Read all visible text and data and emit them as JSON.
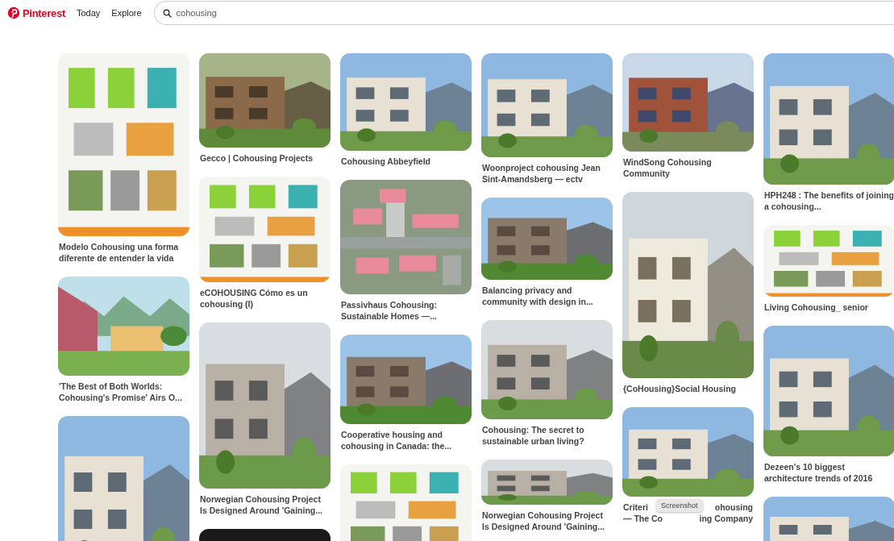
{
  "header": {
    "brand": "Pinterest",
    "nav": [
      {
        "label": "Today"
      },
      {
        "label": "Explore"
      }
    ],
    "search": {
      "value": "cohousing"
    }
  },
  "columns": [
    {
      "pins": [
        {
          "kind": "picture",
          "caption": "Modelo Cohousing una forma diferente de entender la vida"
        },
        {
          "kind": "picture",
          "caption": "'The Best of Both Worlds: Cohousing's Promise' Airs O..."
        },
        {
          "kind": "picture"
        }
      ]
    },
    {
      "pins": [
        {
          "kind": "picture",
          "caption": "Gecco | Cohousing Projects"
        },
        {
          "kind": "picture",
          "caption": "eCOHOUSING Cómo es un cohousing (I)"
        },
        {
          "kind": "picture",
          "caption": "Norwegian Cohousing Project Is Designed Around 'Gaining..."
        },
        {
          "kind": "picture"
        }
      ]
    },
    {
      "pins": [
        {
          "kind": "picture",
          "caption": "Cohousing Abbeyfield"
        },
        {
          "kind": "picture",
          "caption": "Passivhaus Cohousing: Sustainable Homes —..."
        },
        {
          "kind": "picture",
          "caption": "Cooperative housing and cohousing in Canada: the..."
        },
        {
          "kind": "picture"
        }
      ]
    },
    {
      "pins": [
        {
          "kind": "picture",
          "caption": "Woonproject cohousing Jean Sint-Amandsberg — ectv"
        },
        {
          "kind": "picture",
          "caption": "Balancing privacy and community with design in..."
        },
        {
          "kind": "picture",
          "caption": "Cohousing: The secret to sustainable urban living?"
        },
        {
          "kind": "picture",
          "caption": "Norwegian Cohousing Project Is Designed Around 'Gaining..."
        }
      ]
    },
    {
      "pins": [
        {
          "kind": "picture",
          "caption": "WindSong Cohousing Community"
        },
        {
          "kind": "picture",
          "caption": "{CoHousing}Social Housing"
        },
        {
          "kind": "picture",
          "caption_fragments": [
            [
              "Criteri",
              "ohousing"
            ],
            [
              "— The Co",
              "ing Company"
            ]
          ],
          "tooltip": "Screenshot"
        }
      ]
    },
    {
      "pins": [
        {
          "kind": "picture",
          "caption": "HPH248 : The benefits of joining a cohousing..."
        },
        {
          "kind": "picture",
          "caption": "Living Cohousing_ senior"
        },
        {
          "kind": "picture",
          "caption": "Dezeen's 10 biggest architecture trends of 2016"
        },
        {
          "kind": "picture"
        }
      ]
    }
  ]
}
